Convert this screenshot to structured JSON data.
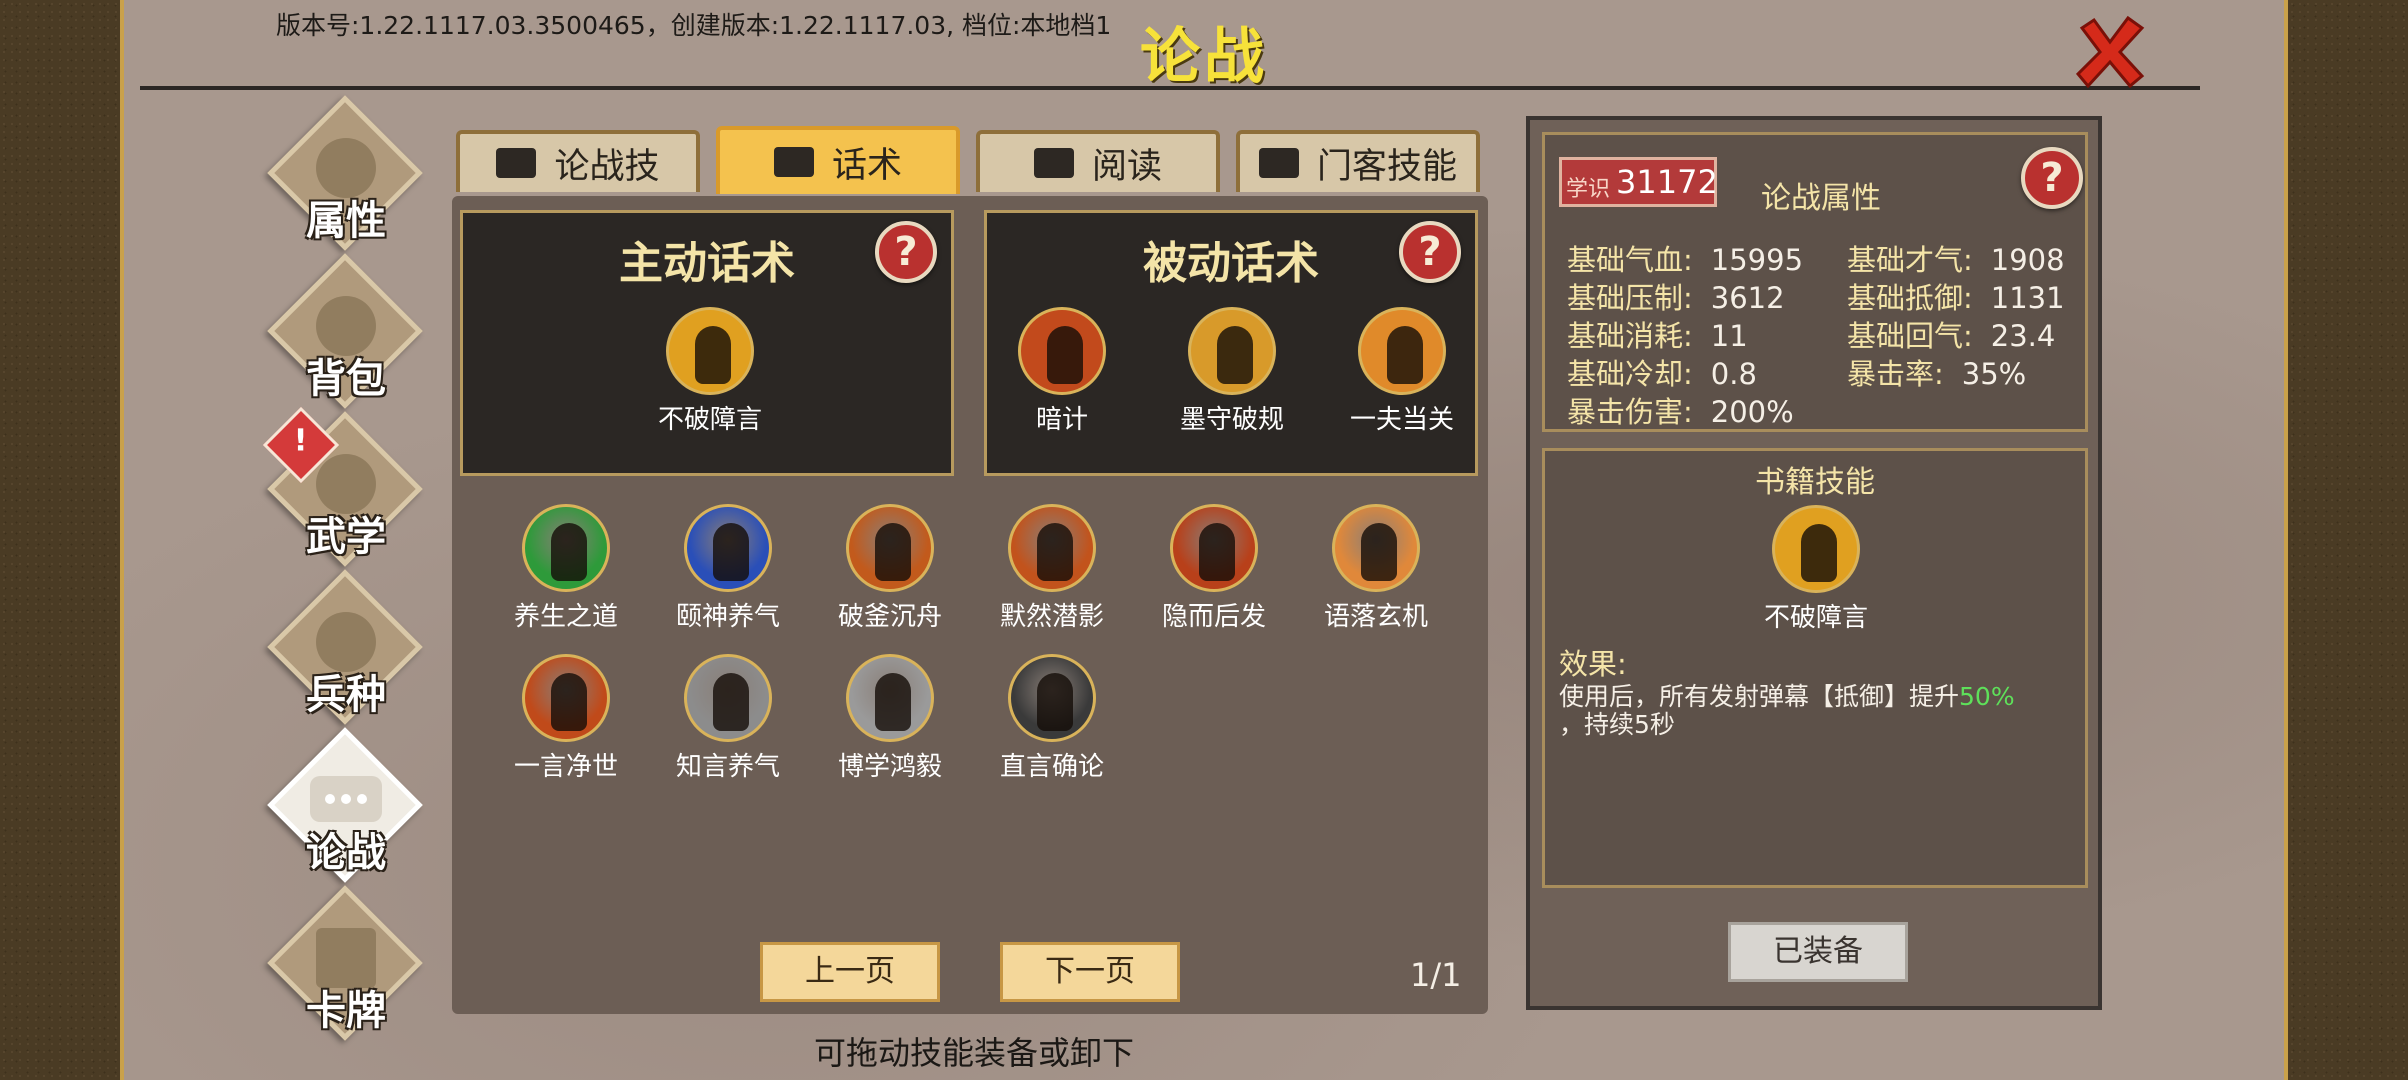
{
  "header": {
    "version_text": "版本号:1.22.1117.03.3500465，创建版本:1.22.1117.03, 档位:本地档1",
    "title": "论战"
  },
  "sidebar": {
    "items": [
      {
        "label": "属性"
      },
      {
        "label": "背包"
      },
      {
        "label": "武学",
        "alert": "!"
      },
      {
        "label": "兵种"
      },
      {
        "label": "论战",
        "active": true
      },
      {
        "label": "卡牌"
      }
    ]
  },
  "tabs": [
    {
      "label": "论战技",
      "icon": "book-icon"
    },
    {
      "label": "话术",
      "icon": "speech-icon",
      "active": true
    },
    {
      "label": "阅读",
      "icon": "open-book-icon"
    },
    {
      "label": "门客技能",
      "icon": "speech-icon"
    }
  ],
  "active_box": {
    "title": "主动话术",
    "skills": [
      {
        "name": "不破障言"
      }
    ]
  },
  "passive_box": {
    "title": "被动话术",
    "skills": [
      {
        "name": "暗计"
      },
      {
        "name": "墨守破规"
      },
      {
        "name": "一夫当关"
      }
    ]
  },
  "skill_grid": [
    {
      "name": "养生之道",
      "color": "#2e9a3a"
    },
    {
      "name": "颐神养气",
      "color": "#2a4fb8"
    },
    {
      "name": "破釜沉舟",
      "color": "#c25a1c"
    },
    {
      "name": "默然潜影",
      "color": "#c2531c"
    },
    {
      "name": "隐而后发",
      "color": "#b8401a"
    },
    {
      "name": "语落玄机",
      "color": "#e0883a"
    },
    {
      "name": "一言净世",
      "color": "#c04a1a"
    },
    {
      "name": "知言养气",
      "color": "#8c8c8c"
    },
    {
      "name": "博学鸿毅",
      "color": "#9a9a9a"
    },
    {
      "name": "直言确论",
      "color": "#3a3a3a"
    }
  ],
  "pager": {
    "prev_label": "上一页",
    "next_label": "下一页",
    "page_text": "1/1"
  },
  "hint_text": "可拖动技能装备或卸下",
  "right_panel": {
    "xueshi_tag": "学识",
    "xueshi_value": "31172",
    "attr_title": "论战属性",
    "help": "?",
    "attributes": [
      {
        "key": "基础气血:",
        "value": "15995"
      },
      {
        "key": "基础才气:",
        "value": "1908"
      },
      {
        "key": "基础压制:",
        "value": "3612"
      },
      {
        "key": "基础抵御:",
        "value": "1131"
      },
      {
        "key": "基础消耗:",
        "value": "11"
      },
      {
        "key": "基础回气:",
        "value": "23.4"
      },
      {
        "key": "基础冷却:",
        "value": "0.8"
      },
      {
        "key": "暴击率:",
        "value": "35%"
      },
      {
        "key": "暴击伤害:",
        "value": "200%"
      }
    ],
    "book_title": "书籍技能",
    "book_skill": "不破障言",
    "effect_label": "效果:",
    "effect_text_a": "使用后，所有发射弹幕【抵御】提升",
    "effect_highlight": "50%",
    "effect_text_b": "，持续5秒",
    "equipped_label": "已装备"
  },
  "colors": {
    "title": "#f7e23a",
    "highlight": "#5ee05a",
    "tab_active": "#f4c24e",
    "help_red": "#b9312f"
  }
}
